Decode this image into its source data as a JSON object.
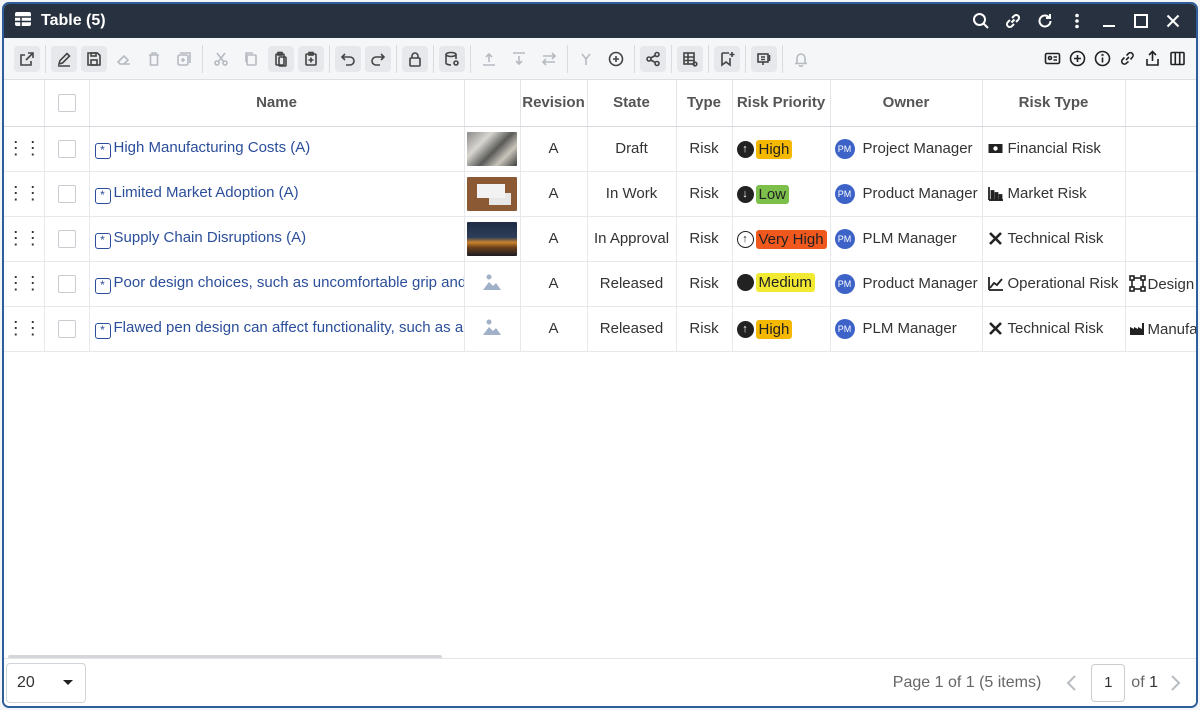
{
  "window": {
    "title": "Table (5)"
  },
  "table": {
    "columns": [
      "Name",
      "Revision",
      "State",
      "Type",
      "Risk Priority",
      "Owner",
      "Risk Type"
    ],
    "rows": [
      {
        "name": "High Manufacturing Costs (A)",
        "revision": "A",
        "state": "Draft",
        "type": "Risk",
        "priority": "High",
        "priority_color": "#f5b800",
        "priority_icon": "arrow-up-circle-icon",
        "owner": "Project Manager",
        "owner_initials": "PM",
        "risk_type": "Financial Risk",
        "risk_type_icon": "money-icon",
        "extra": ""
      },
      {
        "name": "Limited Market Adoption (A)",
        "revision": "A",
        "state": "In Work",
        "type": "Risk",
        "priority": "Low",
        "priority_color": "#7cc04b",
        "priority_icon": "arrow-down-circle-icon",
        "owner": "Product Manager",
        "owner_initials": "PM",
        "risk_type": "Market Risk",
        "risk_type_icon": "bar-chart-icon",
        "extra": ""
      },
      {
        "name": "Supply Chain Disruptions (A)",
        "revision": "A",
        "state": "In Approval",
        "type": "Risk",
        "priority": "Very High",
        "priority_color": "#f0581e",
        "priority_icon": "arrow-up-ring-icon",
        "owner": "PLM Manager",
        "owner_initials": "PM",
        "risk_type": "Technical Risk",
        "risk_type_icon": "tools-icon",
        "extra": ""
      },
      {
        "name": "Poor design choices, such as uncomfortable grip and",
        "revision": "A",
        "state": "Released",
        "type": "Risk",
        "priority": "Medium",
        "priority_color": "#f2e933",
        "priority_icon": "dot-circle-icon",
        "owner": "Product Manager",
        "owner_initials": "PM",
        "risk_type": "Operational Risk",
        "risk_type_icon": "line-chart-icon",
        "extra": "Design"
      },
      {
        "name": "Flawed pen design can affect functionality, such as a p",
        "revision": "A",
        "state": "Released",
        "type": "Risk",
        "priority": "High",
        "priority_color": "#f5b800",
        "priority_icon": "arrow-up-circle-icon",
        "owner": "PLM Manager",
        "owner_initials": "PM",
        "risk_type": "Technical Risk",
        "risk_type_icon": "tools-icon",
        "extra": "Manufa"
      }
    ]
  },
  "footer": {
    "page_size": "20",
    "page_info": "Page 1 of 1 (5 items)",
    "current_page": "1",
    "of_label": "of",
    "total_pages": "1"
  }
}
